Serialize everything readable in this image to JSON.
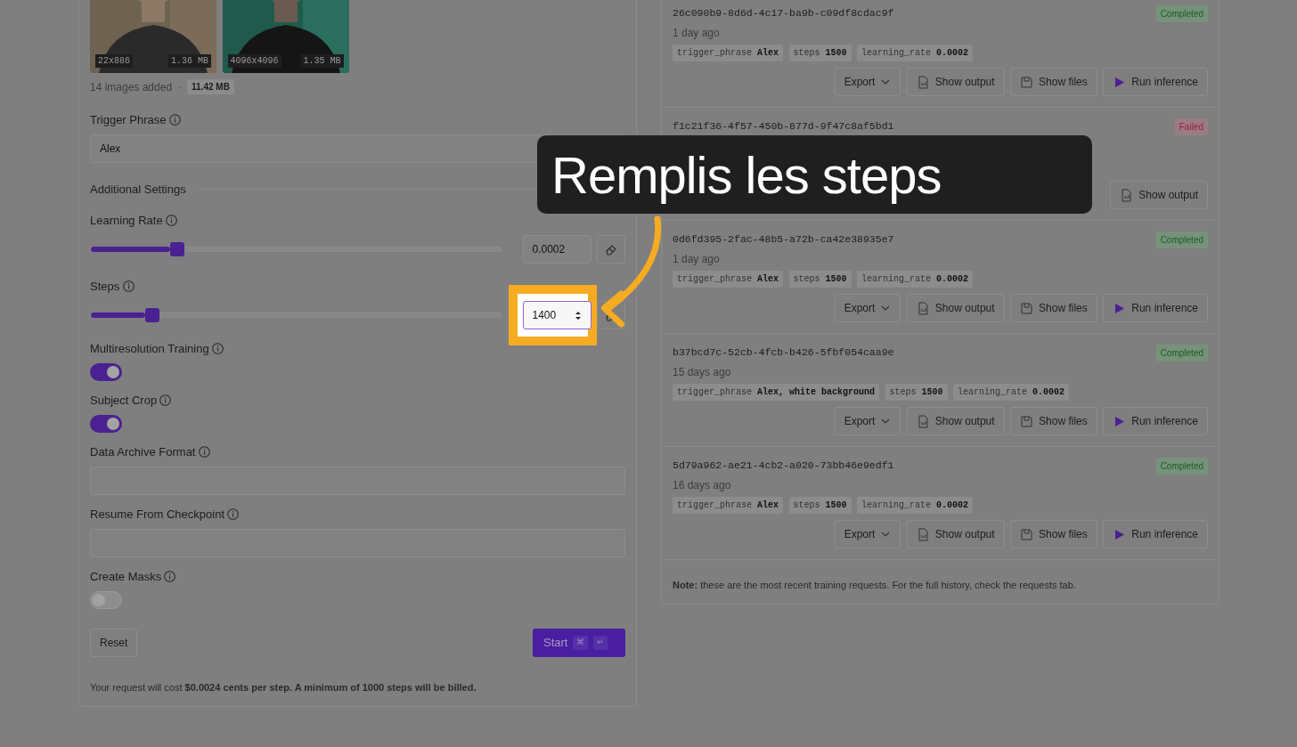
{
  "images": [
    {
      "dimensions": "22x886",
      "size": "1.36 MB"
    },
    {
      "dimensions": "4096x4096",
      "size": "1.35 MB"
    }
  ],
  "images_summary": {
    "text": "14 images added",
    "separator": "·",
    "size": "11.42 MB"
  },
  "trigger_phrase": {
    "label": "Trigger Phrase",
    "value": "Alex"
  },
  "additional_settings": {
    "label": "Additional Settings"
  },
  "fields": [
    {
      "kind": "slider",
      "label": "Learning Rate",
      "level": 0.21,
      "value": "0.0002",
      "focused": false
    },
    {
      "kind": "slider",
      "label": "Steps",
      "level": 0.15,
      "value": "1400",
      "focused": true
    },
    {
      "kind": "toggle",
      "label": "Multiresolution Training",
      "on": true
    },
    {
      "kind": "toggle",
      "label": "Subject Crop",
      "on": true
    },
    {
      "kind": "text",
      "label": "Data Archive Format"
    },
    {
      "kind": "text",
      "label": "Resume From Checkpoint"
    },
    {
      "kind": "toggle",
      "label": "Create Masks",
      "on": false
    }
  ],
  "reset_button": "Reset",
  "start_button": {
    "label": "Start",
    "keys": [
      "⌘",
      "↵"
    ]
  },
  "cost_note": "Your request will cost **$0.0024 cents per step. A minimum of 1000 steps will be billed.**",
  "requests": [
    {
      "id": "26c090b9-8d6d-4c17-ba9b-c09df8cdac9f",
      "time": "1 day ago",
      "kind": "completed",
      "status_label": "Completed",
      "tags": [
        {
          "key": "trigger_phrase",
          "value": "Alex"
        },
        {
          "key": "steps",
          "value": "1500"
        },
        {
          "key": "learning_rate",
          "value": "0.0002"
        }
      ],
      "actions": [
        {
          "kind": "export",
          "label": "Export"
        },
        {
          "kind": "output",
          "label": "Show output"
        },
        {
          "kind": "files",
          "label": "Show files"
        },
        {
          "kind": "inference",
          "label": "Run inference"
        }
      ]
    },
    {
      "id": "f1c21f36-4f57-450b-877d-9f47c8af5bd1",
      "kind": "failed",
      "status_label": "Failed",
      "actions": [
        {
          "kind": "output",
          "label": "Show output"
        }
      ]
    },
    {
      "id": "0d6fd395-2fac-48b5-a72b-ca42e38935e7",
      "time": "1 day ago",
      "kind": "completed",
      "status_label": "Completed",
      "tags": [
        {
          "key": "trigger_phrase",
          "value": "Alex"
        },
        {
          "key": "steps",
          "value": "1500"
        },
        {
          "key": "learning_rate",
          "value": "0.0002"
        }
      ],
      "actions": [
        {
          "kind": "export",
          "label": "Export"
        },
        {
          "kind": "output",
          "label": "Show output"
        },
        {
          "kind": "files",
          "label": "Show files"
        },
        {
          "kind": "inference",
          "label": "Run inference"
        }
      ]
    },
    {
      "id": "b37bcd7c-52cb-4fcb-b426-5fbf054caa9e",
      "time": "15 days ago",
      "kind": "completed",
      "status_label": "Completed",
      "tags": [
        {
          "key": "trigger_phrase",
          "value": "Alex, white background"
        },
        {
          "key": "steps",
          "value": "1500"
        },
        {
          "key": "learning_rate",
          "value": "0.0002"
        }
      ],
      "actions": [
        {
          "kind": "export",
          "label": "Export"
        },
        {
          "kind": "output",
          "label": "Show output"
        },
        {
          "kind": "files",
          "label": "Show files"
        },
        {
          "kind": "inference",
          "label": "Run inference"
        }
      ]
    },
    {
      "id": "5d79a962-ae21-4cb2-a020-73bb46e9edf1",
      "time": "16 days ago",
      "kind": "completed",
      "status_label": "Completed",
      "tags": [
        {
          "key": "trigger_phrase",
          "value": "Alex"
        },
        {
          "key": "steps",
          "value": "1500"
        },
        {
          "key": "learning_rate",
          "value": "0.0002"
        }
      ],
      "actions": [
        {
          "kind": "export",
          "label": "Export"
        },
        {
          "kind": "output",
          "label": "Show output"
        },
        {
          "kind": "files",
          "label": "Show files"
        },
        {
          "kind": "inference",
          "label": "Run inference"
        }
      ]
    }
  ],
  "note": "**Note:** these are the most recent training requests. For the full history, check the requests tab.",
  "callout": {
    "text": "Remplis les steps"
  }
}
